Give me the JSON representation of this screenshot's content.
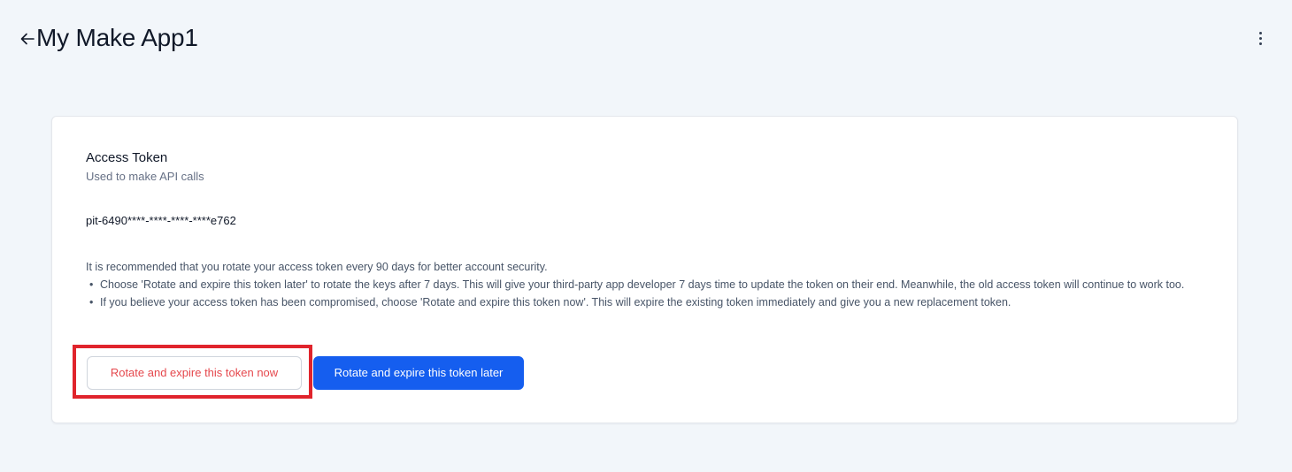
{
  "header": {
    "back_icon": "arrow-left-icon",
    "title": "My Make App1",
    "menu_icon": "more-vertical-icon"
  },
  "access_token": {
    "title": "Access Token",
    "subtitle": "Used to make API calls",
    "value": "pit-6490****-****-****-****e762",
    "recommendation": "It is recommended that you rotate your access token every 90 days for better account security.",
    "bullets": [
      "Choose 'Rotate and expire this token later' to rotate the keys after 7 days. This will give your third-party app developer 7 days time to update the token on their end. Meanwhile, the old access token will continue to work too.",
      "If you believe your access token has been compromised, choose 'Rotate and expire this token now'. This will expire the existing token immediately and give you a new replacement token."
    ],
    "rotate_now_label": "Rotate and expire this token now",
    "rotate_later_label": "Rotate and expire this token later"
  },
  "colors": {
    "background": "#f2f6fa",
    "primary": "#155eef",
    "danger_text": "#e5484d",
    "highlight_border": "#e0242c"
  }
}
